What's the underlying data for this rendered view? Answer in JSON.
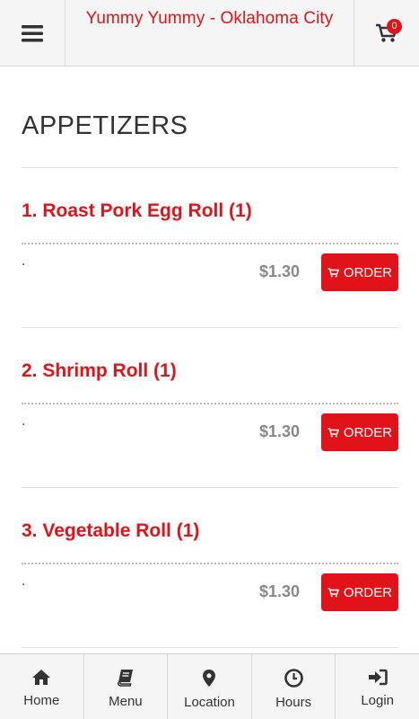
{
  "header": {
    "title": "Yummy Yummy - Oklahoma City",
    "cart_count": "0"
  },
  "category": {
    "title": "APPETIZERS"
  },
  "items": [
    {
      "name": "1. Roast Pork Egg Roll (1)",
      "description": ".",
      "price": "$1.30",
      "order_label": "ORDER"
    },
    {
      "name": "2. Shrimp Roll (1)",
      "description": ".",
      "price": "$1.30",
      "order_label": "ORDER"
    },
    {
      "name": "3. Vegetable Roll (1)",
      "description": ".",
      "price": "$1.30",
      "order_label": "ORDER"
    }
  ],
  "footer": {
    "tabs": [
      {
        "label": "Home",
        "icon": "home-icon"
      },
      {
        "label": "Menu",
        "icon": "book-icon"
      },
      {
        "label": "Location",
        "icon": "map-pin-icon"
      },
      {
        "label": "Hours",
        "icon": "clock-icon"
      },
      {
        "label": "Login",
        "icon": "sign-in-icon"
      }
    ]
  },
  "colors": {
    "accent": "#e0131a",
    "price": "#888888"
  }
}
